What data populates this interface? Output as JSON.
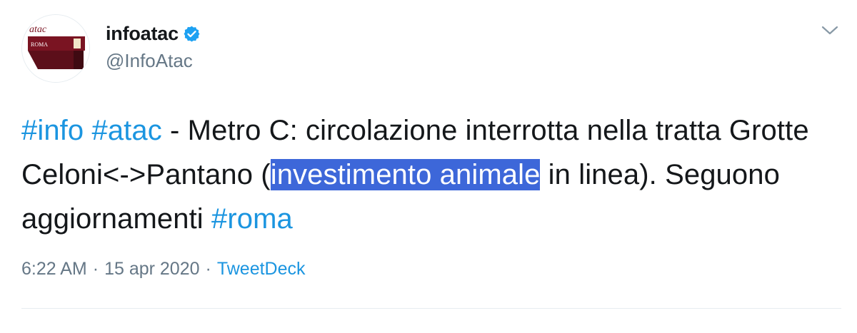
{
  "user": {
    "display_name": "infoatac",
    "handle": "@InfoAtac",
    "verified": true,
    "avatar_logo_text": "atac",
    "avatar_sub_text": "ROMA"
  },
  "tweet": {
    "hashtag_info": "#info",
    "hashtag_atac": "#atac",
    "text_part1": " - Metro C: circolazione interrotta nella tratta Grotte Celoni<->Pantano (",
    "highlighted_text": "investimento animale",
    "text_part2": " in linea). Seguono aggiornamenti ",
    "hashtag_roma": "#roma",
    "selection_color": "#3d67d9"
  },
  "meta": {
    "time": "6:22 AM",
    "separator1": "·",
    "date": "15 apr 2020",
    "separator2": "·",
    "source": "TweetDeck"
  },
  "icons": {
    "verified": "verified-badge-icon",
    "caret": "chevron-down-icon"
  },
  "colors": {
    "link": "#1b95e0",
    "secondary": "#657786",
    "brand_maroon": "#7a1422"
  }
}
